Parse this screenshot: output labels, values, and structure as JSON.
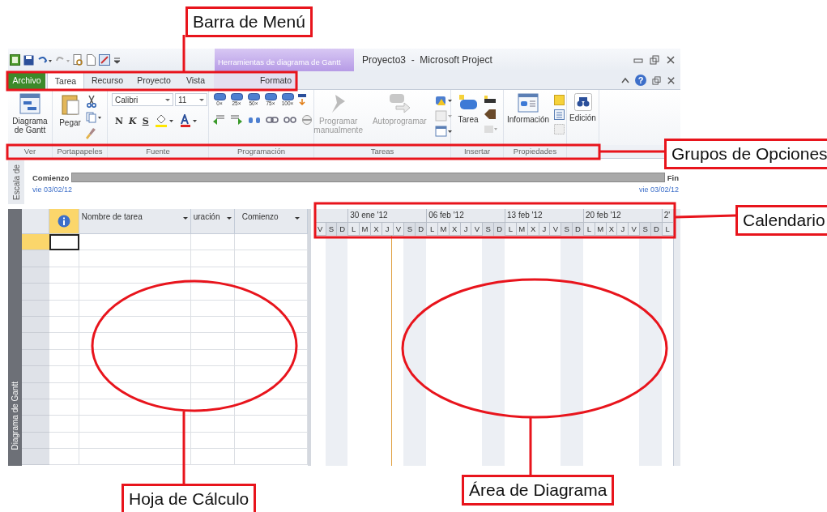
{
  "window": {
    "title": "Proyecto3  -  Microsoft Project",
    "context_tab": "Herramientas de diagrama de Gantt",
    "help_glyph": "?"
  },
  "tabs": [
    {
      "label": "Archivo",
      "kind": "file",
      "selected": false
    },
    {
      "label": "Tarea",
      "kind": "tab",
      "selected": true
    },
    {
      "label": "Recurso",
      "kind": "tab",
      "selected": false
    },
    {
      "label": "Proyecto",
      "kind": "tab",
      "selected": false
    },
    {
      "label": "Vista",
      "kind": "tab",
      "selected": false
    },
    {
      "label": "Formato",
      "kind": "context",
      "selected": false
    }
  ],
  "ribbon": {
    "gantt_button": "Diagrama de Gantt",
    "paste_button": "Pegar",
    "font_name": "Calibri",
    "font_size": "11",
    "bold": "N",
    "italic": "K",
    "underline": "S",
    "progress_buttons": [
      "0×",
      "25×",
      "50×",
      "75×",
      "100×"
    ],
    "manual_button": {
      "label": "Programar manualmente",
      "disabled": true
    },
    "auto_button": {
      "label": "Autoprogramar",
      "disabled": true
    },
    "task_button": "Tarea",
    "info_button": "Información",
    "edit_button": "Edición"
  },
  "group_labels": [
    "Ver",
    "Portapapeles",
    "Fuente",
    "Programación",
    "Tareas",
    "Insertar",
    "Propiedades"
  ],
  "timeline": {
    "side_label": "Escala de",
    "start_label": "Comienzo",
    "end_label": "Fin",
    "start_date": "vie 03/02/12",
    "end_date": "vie 03/02/12"
  },
  "view_bar": {
    "label": "Diagrama de Gantt"
  },
  "sheet": {
    "columns": [
      "Nombre de tarea",
      "uración",
      "Comienzo"
    ],
    "rows": [
      {
        "selected": true
      },
      {
        "selected": false
      },
      {
        "selected": false
      },
      {
        "selected": false
      },
      {
        "selected": false
      },
      {
        "selected": false
      },
      {
        "selected": false
      },
      {
        "selected": false
      },
      {
        "selected": false
      },
      {
        "selected": false
      },
      {
        "selected": false
      },
      {
        "selected": false
      },
      {
        "selected": false
      },
      {
        "selected": false
      }
    ]
  },
  "calendar": {
    "weeks": [
      {
        "days": [
          {
            "d": "V",
            "nonworking": false
          },
          {
            "d": "S",
            "nonworking": true
          },
          {
            "d": "D",
            "nonworking": true
          }
        ]
      },
      {
        "label": "30 ene '12",
        "days": [
          {
            "d": "L",
            "nonworking": false
          },
          {
            "d": "M",
            "nonworking": false
          },
          {
            "d": "X",
            "nonworking": false
          },
          {
            "d": "J",
            "nonworking": false
          },
          {
            "d": "V",
            "nonworking": false
          },
          {
            "d": "S",
            "nonworking": true
          },
          {
            "d": "D",
            "nonworking": true
          }
        ]
      },
      {
        "label": "06 feb '12",
        "days": [
          {
            "d": "L",
            "nonworking": false
          },
          {
            "d": "M",
            "nonworking": false
          },
          {
            "d": "X",
            "nonworking": false
          },
          {
            "d": "J",
            "nonworking": false
          },
          {
            "d": "V",
            "nonworking": false
          },
          {
            "d": "S",
            "nonworking": true
          },
          {
            "d": "D",
            "nonworking": true
          }
        ]
      },
      {
        "label": "13 feb '12",
        "days": [
          {
            "d": "L",
            "nonworking": false
          },
          {
            "d": "M",
            "nonworking": false
          },
          {
            "d": "X",
            "nonworking": false
          },
          {
            "d": "J",
            "nonworking": false
          },
          {
            "d": "V",
            "nonworking": false
          },
          {
            "d": "S",
            "nonworking": true
          },
          {
            "d": "D",
            "nonworking": true
          }
        ]
      },
      {
        "label": "20 feb '12",
        "days": [
          {
            "d": "L",
            "nonworking": false
          },
          {
            "d": "M",
            "nonworking": false
          },
          {
            "d": "X",
            "nonworking": false
          },
          {
            "d": "J",
            "nonworking": false
          },
          {
            "d": "V",
            "nonworking": false
          },
          {
            "d": "S",
            "nonworking": true
          },
          {
            "d": "D",
            "nonworking": true
          }
        ]
      },
      {
        "label": "2'",
        "days": [
          {
            "d": "L",
            "nonworking": false
          }
        ]
      }
    ]
  },
  "callouts": [
    "Barra de Menú",
    "Grupos de Opciones",
    "Calendario",
    "Hoja de Cálculo",
    "Área de Diagrama"
  ]
}
